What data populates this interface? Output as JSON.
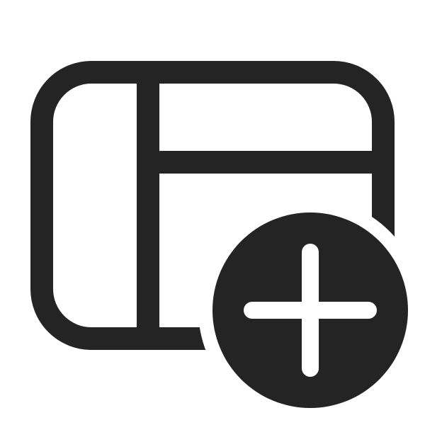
{
  "icon": {
    "name": "table-add-icon",
    "color": "#242424",
    "background": "#ffffff"
  }
}
